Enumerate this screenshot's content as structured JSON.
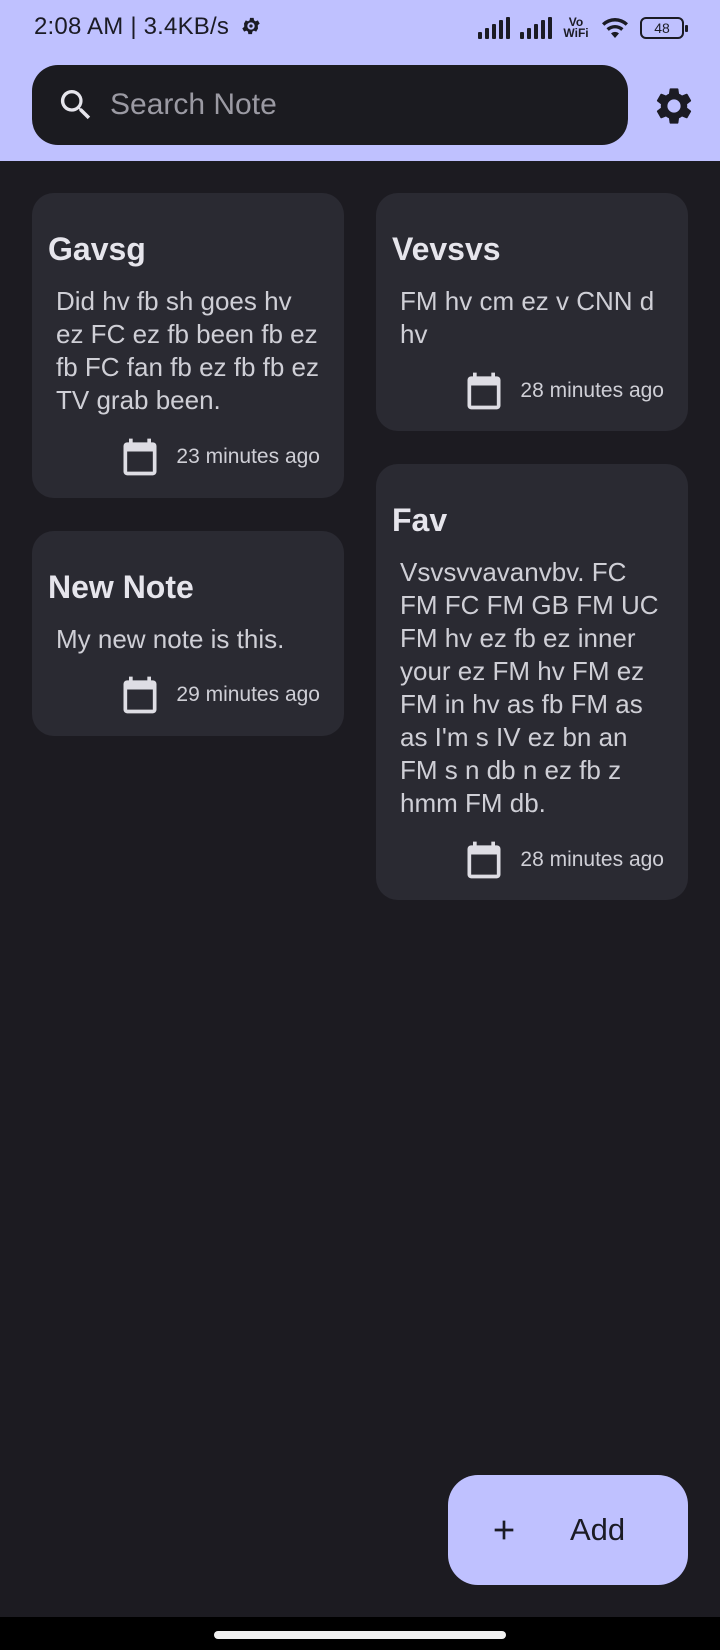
{
  "status_bar": {
    "time": "2:08 AM | 3.4KB/s",
    "vowifi": "Vo WiFi",
    "battery": "48"
  },
  "search": {
    "placeholder": "Search Note",
    "value": ""
  },
  "notes": [
    {
      "title": "Gavsg",
      "body": "Did hv fb sh goes hv ez FC ez fb been fb ez fb FC fan fb ez fb fb ez TV grab been.",
      "time": "23 minutes ago"
    },
    {
      "title": "Vevsvs",
      "body": "FM hv cm ez v CNN d hv",
      "time": "28 minutes ago"
    },
    {
      "title": "New Note",
      "body": "My new note is this.",
      "time": "29 minutes ago"
    },
    {
      "title": "Fav",
      "body": "Vsvsvvavanvbv. FC FM FC FM GB FM UC FM hv ez fb ez inner your ez FM hv FM ez FM in hv as fb FM as as I'm s IV ez bn an FM s n db n ez fb z hmm FM db.",
      "time": "28 minutes ago"
    }
  ],
  "fab": {
    "label": "Add"
  },
  "colors": {
    "accent": "#bfc1ff",
    "background": "#1c1b21",
    "card": "#2a2a32"
  }
}
